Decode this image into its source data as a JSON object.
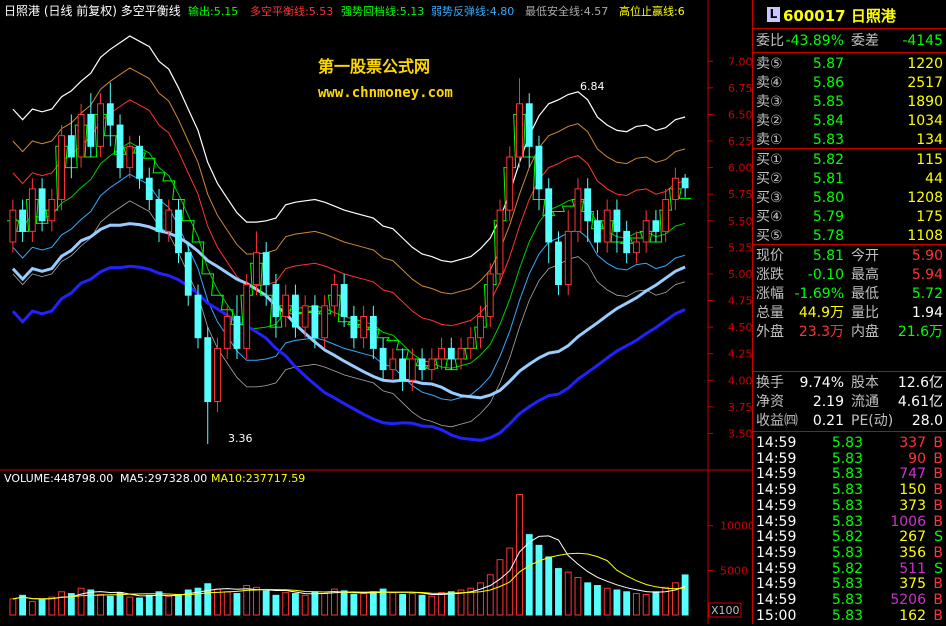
{
  "chart_header": {
    "title": "日照港 (日线 前复权) 多空平衡线",
    "indicators": [
      {
        "label": "输出:5.15",
        "color": "#00ff00"
      },
      {
        "label": "多空平衡线:5.53",
        "color": "#ff3333"
      },
      {
        "label": "强势回档线:5.13",
        "color": "#00ff00"
      },
      {
        "label": "弱势反弹线:4.80",
        "color": "#33aaff"
      },
      {
        "label": "最低安全线:4.57",
        "color": "#aaaaaa"
      },
      {
        "label": "高位止赢线:6",
        "color": "#ffff00"
      }
    ]
  },
  "watermark": {
    "line1": "第一股票公式网",
    "line2": "www.chnmoney.com"
  },
  "price_axis": [
    "7.00",
    "6.75",
    "6.50",
    "6.25",
    "6.00",
    "5.75",
    "5.50",
    "5.25",
    "5.00",
    "4.75",
    "4.50",
    "4.25",
    "4.00",
    "3.75",
    "3.50"
  ],
  "annotations": {
    "high": "6.84",
    "low": "3.36"
  },
  "volume_header": {
    "volume": "VOLUME:448798.00",
    "ma5": "MA5:297328.00",
    "ma10": "MA10:237717.59"
  },
  "volume_axis": [
    "10000",
    "5000"
  ],
  "volume_unit": "X100",
  "quote": {
    "code": "600017",
    "name": "日照港",
    "badge": "L",
    "weibi_label": "委比",
    "weibi_value": "-43.89%",
    "weicha_label": "委差",
    "weicha_value": "-4145",
    "asks": [
      {
        "label": "卖⑤",
        "price": "5.87",
        "vol": "1220"
      },
      {
        "label": "卖④",
        "price": "5.86",
        "vol": "2517"
      },
      {
        "label": "卖③",
        "price": "5.85",
        "vol": "1890"
      },
      {
        "label": "卖②",
        "price": "5.84",
        "vol": "1034"
      },
      {
        "label": "卖①",
        "price": "5.83",
        "vol": "134"
      }
    ],
    "bids": [
      {
        "label": "买①",
        "price": "5.82",
        "vol": "115"
      },
      {
        "label": "买②",
        "price": "5.81",
        "vol": "44"
      },
      {
        "label": "买③",
        "price": "5.80",
        "vol": "1208"
      },
      {
        "label": "买④",
        "price": "5.79",
        "vol": "175"
      },
      {
        "label": "买⑤",
        "price": "5.78",
        "vol": "1108"
      }
    ],
    "stats": [
      {
        "l1": "现价",
        "v1": "5.81",
        "c1": "#00ff00",
        "l2": "今开",
        "v2": "5.90",
        "c2": "#ff3333"
      },
      {
        "l1": "涨跌",
        "v1": "-0.10",
        "c1": "#00ff00",
        "l2": "最高",
        "v2": "5.94",
        "c2": "#ff3333"
      },
      {
        "l1": "涨幅",
        "v1": "-1.69%",
        "c1": "#00ff00",
        "l2": "最低",
        "v2": "5.72",
        "c2": "#00ff00"
      },
      {
        "l1": "总量",
        "v1": "44.9万",
        "c1": "#ffff00",
        "l2": "量比",
        "v2": "1.94",
        "c2": "#ffffff"
      },
      {
        "l1": "外盘",
        "v1": "23.3万",
        "c1": "#ff3333",
        "l2": "内盘",
        "v2": "21.6万",
        "c2": "#00ff00"
      }
    ],
    "finance": [
      {
        "l1": "换手",
        "v1": "9.74%",
        "l2": "股本",
        "v2": "12.6亿"
      },
      {
        "l1": "净资",
        "v1": "2.19",
        "l2": "流通",
        "v2": "4.61亿"
      },
      {
        "l1": "收益㈣",
        "v1": "0.21",
        "l2": "PE(动)",
        "v2": "28.0"
      }
    ],
    "ticks": [
      {
        "t": "14:59",
        "p": "5.83",
        "v": "337",
        "vc": "#ff3333",
        "s": "B"
      },
      {
        "t": "14:59",
        "p": "5.83",
        "v": "90",
        "vc": "#ff3333",
        "s": "B"
      },
      {
        "t": "14:59",
        "p": "5.83",
        "v": "747",
        "vc": "#cc33cc",
        "s": "B"
      },
      {
        "t": "14:59",
        "p": "5.83",
        "v": "150",
        "vc": "#ffff00",
        "s": "B"
      },
      {
        "t": "14:59",
        "p": "5.83",
        "v": "373",
        "vc": "#ffff00",
        "s": "B"
      },
      {
        "t": "14:59",
        "p": "5.83",
        "v": "1006",
        "vc": "#cc33cc",
        "s": "B"
      },
      {
        "t": "14:59",
        "p": "5.82",
        "v": "267",
        "vc": "#ffff00",
        "s": "S"
      },
      {
        "t": "14:59",
        "p": "5.83",
        "v": "356",
        "vc": "#ffff00",
        "s": "B"
      },
      {
        "t": "14:59",
        "p": "5.82",
        "v": "511",
        "vc": "#cc33cc",
        "s": "S"
      },
      {
        "t": "14:59",
        "p": "5.83",
        "v": "375",
        "vc": "#ffff00",
        "s": "B"
      },
      {
        "t": "14:59",
        "p": "5.83",
        "v": "5206",
        "vc": "#cc33cc",
        "s": "B"
      },
      {
        "t": "15:00",
        "p": "5.83",
        "v": "162",
        "vc": "#ffff00",
        "s": "B"
      }
    ]
  },
  "chart_data": {
    "type": "line",
    "x_count": 70,
    "ylim": [
      3.25,
      7.2
    ],
    "candles": [
      [
        5.3,
        5.6,
        5.2,
        5.7
      ],
      [
        5.6,
        5.4,
        5.3,
        5.7
      ],
      [
        5.4,
        5.8,
        5.3,
        5.9
      ],
      [
        5.8,
        5.5,
        5.4,
        5.9
      ],
      [
        5.5,
        5.7,
        5.4,
        5.8
      ],
      [
        5.7,
        6.3,
        5.6,
        6.4
      ],
      [
        6.3,
        6.1,
        5.9,
        6.5
      ],
      [
        6.1,
        6.5,
        6.0,
        6.6
      ],
      [
        6.5,
        6.2,
        6.1,
        6.7
      ],
      [
        6.2,
        6.6,
        6.1,
        6.7
      ],
      [
        6.6,
        6.4,
        6.2,
        6.8
      ],
      [
        6.4,
        6.0,
        5.9,
        6.5
      ],
      [
        6.0,
        6.2,
        5.9,
        6.3
      ],
      [
        6.2,
        5.9,
        5.8,
        6.3
      ],
      [
        5.9,
        5.7,
        5.6,
        6.0
      ],
      [
        5.7,
        5.4,
        5.3,
        5.8
      ],
      [
        5.4,
        5.6,
        5.3,
        5.7
      ],
      [
        5.6,
        5.2,
        5.1,
        5.7
      ],
      [
        5.2,
        4.8,
        4.7,
        5.3
      ],
      [
        4.8,
        4.4,
        4.3,
        4.9
      ],
      [
        4.4,
        3.8,
        3.4,
        4.5
      ],
      [
        3.8,
        4.3,
        3.7,
        4.4
      ],
      [
        4.3,
        4.6,
        4.2,
        4.7
      ],
      [
        4.6,
        4.3,
        4.2,
        4.8
      ],
      [
        4.3,
        4.9,
        4.2,
        5.0
      ],
      [
        4.9,
        5.2,
        4.8,
        5.4
      ],
      [
        5.2,
        4.9,
        4.7,
        5.3
      ],
      [
        4.9,
        4.6,
        4.4,
        5.0
      ],
      [
        4.6,
        4.8,
        4.5,
        4.9
      ],
      [
        4.8,
        4.5,
        4.4,
        4.9
      ],
      [
        4.5,
        4.7,
        4.4,
        4.8
      ],
      [
        4.7,
        4.4,
        4.3,
        4.8
      ],
      [
        4.4,
        4.7,
        4.3,
        4.8
      ],
      [
        4.7,
        4.9,
        4.6,
        5.0
      ],
      [
        4.9,
        4.6,
        4.5,
        5.0
      ],
      [
        4.6,
        4.4,
        4.3,
        4.7
      ],
      [
        4.4,
        4.6,
        4.3,
        4.7
      ],
      [
        4.6,
        4.3,
        4.2,
        4.7
      ],
      [
        4.3,
        4.1,
        4.0,
        4.4
      ],
      [
        4.1,
        4.2,
        4.0,
        4.3
      ],
      [
        4.2,
        4.0,
        3.9,
        4.3
      ],
      [
        4.0,
        4.2,
        3.9,
        4.3
      ],
      [
        4.2,
        4.1,
        4.0,
        4.3
      ],
      [
        4.1,
        4.2,
        4.0,
        4.3
      ],
      [
        4.2,
        4.3,
        4.1,
        4.4
      ],
      [
        4.3,
        4.2,
        4.1,
        4.4
      ],
      [
        4.2,
        4.3,
        4.1,
        4.4
      ],
      [
        4.3,
        4.4,
        4.2,
        4.5
      ],
      [
        4.4,
        4.6,
        4.3,
        4.7
      ],
      [
        4.6,
        5.0,
        4.5,
        5.1
      ],
      [
        5.0,
        5.6,
        4.9,
        5.7
      ],
      [
        5.6,
        6.1,
        5.5,
        6.2
      ],
      [
        6.1,
        6.6,
        6.0,
        6.84
      ],
      [
        6.6,
        6.2,
        6.0,
        6.7
      ],
      [
        6.2,
        5.8,
        5.6,
        6.3
      ],
      [
        5.8,
        5.3,
        5.1,
        5.9
      ],
      [
        5.3,
        4.9,
        4.8,
        5.4
      ],
      [
        4.9,
        5.4,
        4.8,
        5.6
      ],
      [
        5.4,
        5.8,
        5.3,
        5.9
      ],
      [
        5.8,
        5.5,
        5.3,
        5.9
      ],
      [
        5.5,
        5.3,
        5.2,
        5.6
      ],
      [
        5.3,
        5.6,
        5.2,
        5.7
      ],
      [
        5.6,
        5.4,
        5.2,
        5.7
      ],
      [
        5.4,
        5.2,
        5.1,
        5.5
      ],
      [
        5.2,
        5.3,
        5.1,
        5.4
      ],
      [
        5.3,
        5.5,
        5.2,
        5.6
      ],
      [
        5.5,
        5.4,
        5.3,
        5.6
      ],
      [
        5.4,
        5.7,
        5.3,
        5.8
      ],
      [
        5.7,
        5.9,
        5.6,
        6.0
      ],
      [
        5.9,
        5.81,
        5.72,
        5.94
      ]
    ],
    "volumes": [
      1800,
      2200,
      1500,
      1700,
      2000,
      2600,
      2400,
      3000,
      2800,
      2300,
      2100,
      2500,
      2000,
      1900,
      2200,
      2600,
      2100,
      2300,
      2800,
      3000,
      3500,
      2900,
      2600,
      2400,
      3300,
      3100,
      2700,
      2200,
      2500,
      2400,
      2200,
      2600,
      2400,
      2900,
      2700,
      2300,
      2400,
      2600,
      2900,
      2500,
      2300,
      2400,
      2200,
      2100,
      2500,
      2600,
      2800,
      3000,
      3600,
      4500,
      6200,
      7500,
      13500,
      9000,
      7800,
      6500,
      5200,
      4800,
      4200,
      3600,
      3300,
      3000,
      2800,
      2600,
      2400,
      2300,
      2600,
      3100,
      3600,
      4488
    ]
  }
}
